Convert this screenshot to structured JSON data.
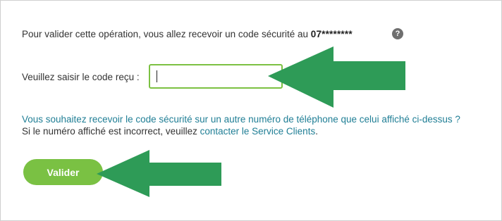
{
  "verification": {
    "info_text": "Pour valider cette opération, vous allez recevoir un code sécurité au ",
    "masked_phone": "07********",
    "help_icon": "question-mark-icon",
    "help_glyph": "?"
  },
  "code_field": {
    "label": "Veuillez saisir le code reçu :",
    "value": ""
  },
  "links": {
    "other_number": "Vous souhaitez recevoir le code sécurité sur un autre numéro de téléphone que celui affiché ci-dessus ?",
    "incorrect_prefix": "Si le numéro affiché est incorrect, veuillez ",
    "contact_service": "contacter le Service Clients",
    "incorrect_suffix": "."
  },
  "actions": {
    "validate_label": "Valider"
  },
  "annotations": {
    "arrow_icon": "left-arrow-icon",
    "arrow_color": "#2e9b57"
  },
  "colors": {
    "accent": "#7ac143",
    "link": "#1f7e95"
  }
}
